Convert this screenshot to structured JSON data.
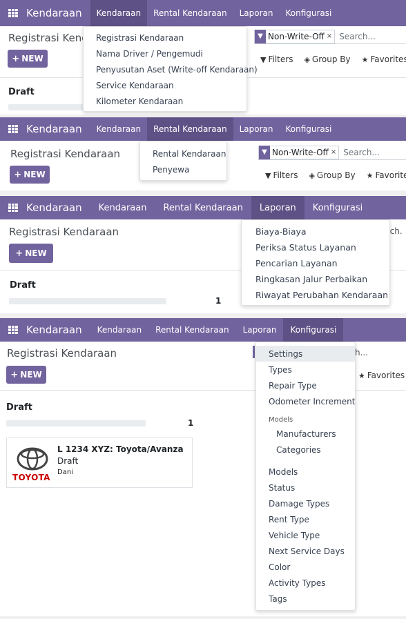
{
  "panels": [
    {
      "brand": "Kendaraan",
      "menu": [
        "Kendaraan",
        "Rental Kendaraan",
        "Laporan",
        "Konfigurasi"
      ],
      "active_index": 0,
      "title": "Registrasi Kend",
      "new_label": "NEW",
      "facet": "Non-Write-Off",
      "search_placeholder": "Search...",
      "toolbar": [
        "Filters",
        "Group By",
        "Favorites"
      ],
      "draft_label": "Draft",
      "dropdown": [
        "Registrasi Kendaraan",
        "Nama Driver / Pengemudi",
        "Penyusutan Aset (Write-off Kendaraan)",
        "Service Kendaraan",
        "Kilometer Kendaraan"
      ]
    },
    {
      "brand": "Kendaraan",
      "menu": [
        "Kendaraan",
        "Rental Kendaraan",
        "Laporan",
        "Konfigurasi"
      ],
      "active_index": 1,
      "title": "Registrasi Kendaraan",
      "new_label": "NEW",
      "facet": "Non-Write-Off",
      "search_placeholder": "Search...",
      "toolbar": [
        "Filters",
        "Group By",
        "Favorites"
      ],
      "dropdown": [
        "Rental Kendaraan",
        "Penyewa"
      ]
    },
    {
      "brand": "Kendaraan",
      "menu": [
        "Kendaraan",
        "Rental Kendaraan",
        "Laporan",
        "Konfigurasi"
      ],
      "active_index": 2,
      "title": "Registrasi Kendaraan",
      "new_label": "NEW",
      "search_partial": "rch.",
      "draft_label": "Draft",
      "count": "1",
      "dropdown": [
        "Biaya-Biaya",
        "Periksa Status Layanan",
        "Pencarian Layanan",
        "Ringkasan Jalur Perbaikan",
        "Riwayat Perubahan Kendaraan"
      ]
    },
    {
      "brand": "Kendaraan",
      "menu": [
        "Kendaraan",
        "Rental Kendaraan",
        "Laporan",
        "Konfigurasi"
      ],
      "active_index": 3,
      "title": "Registrasi Kendaraan",
      "new_label": "NEW",
      "search_partial": "h...",
      "favorites": "Favorites",
      "draft_label": "Draft",
      "count": "1",
      "card": {
        "name": "L 1234 XYZ: Toyota/Avanza",
        "status": "Draft",
        "driver": "Dani",
        "logo_text": "TOYOTA"
      },
      "dropdown_top": [
        "Settings",
        "Types",
        "Repair Type",
        "Odometer Increment"
      ],
      "dropdown_header": "Models",
      "dropdown_sub": [
        "Manufacturers",
        "Categories"
      ],
      "dropdown_bottom": [
        "Models",
        "Status",
        "Damage Types",
        "Rent Type",
        "Vehicle Type",
        "Next Service Days",
        "Color",
        "Activity Types",
        "Tags"
      ]
    }
  ],
  "colors": {
    "brand": "#71639e",
    "active": "#5e5185"
  }
}
